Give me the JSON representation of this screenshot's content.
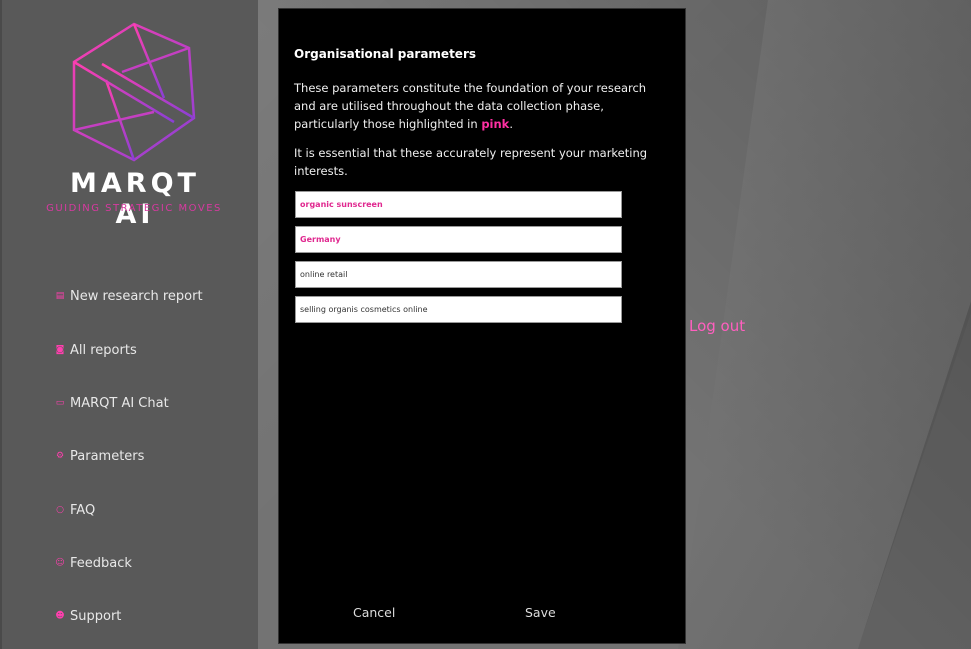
{
  "brand": {
    "name": "MARQT AI",
    "tagline": "GUIDING STRATEGIC MOVES",
    "accent": "#d63aa0"
  },
  "sidebar": {
    "items": [
      {
        "label": "New research report",
        "icon": "report-icon"
      },
      {
        "label": "All reports",
        "icon": "folder-icon"
      },
      {
        "label": "MARQT AI Chat",
        "icon": "chat-icon"
      },
      {
        "label": "Parameters",
        "icon": "gear-icon"
      },
      {
        "label": "FAQ",
        "icon": "speech-bubble-icon"
      },
      {
        "label": "Feedback",
        "icon": "people-icon"
      },
      {
        "label": "Support",
        "icon": "support-icon"
      }
    ]
  },
  "header": {
    "logout": "Log out"
  },
  "modal": {
    "title": "Organisational parameters",
    "intro_before": "These parameters constitute the foundation of your research and are utilised throughout the data collection phase, particularly those highlighted in ",
    "intro_highlight": "pink",
    "intro_after": ".",
    "note": "It is essential that these accurately represent your marketing interests.",
    "fields": [
      {
        "value": "organic sunscreen",
        "highlighted": true
      },
      {
        "value": "Germany",
        "highlighted": true
      },
      {
        "value": "online retail",
        "highlighted": false
      },
      {
        "value": "selling organis cosmetics online",
        "highlighted": false
      }
    ],
    "cancel_label": "Cancel",
    "save_label": "Save"
  }
}
